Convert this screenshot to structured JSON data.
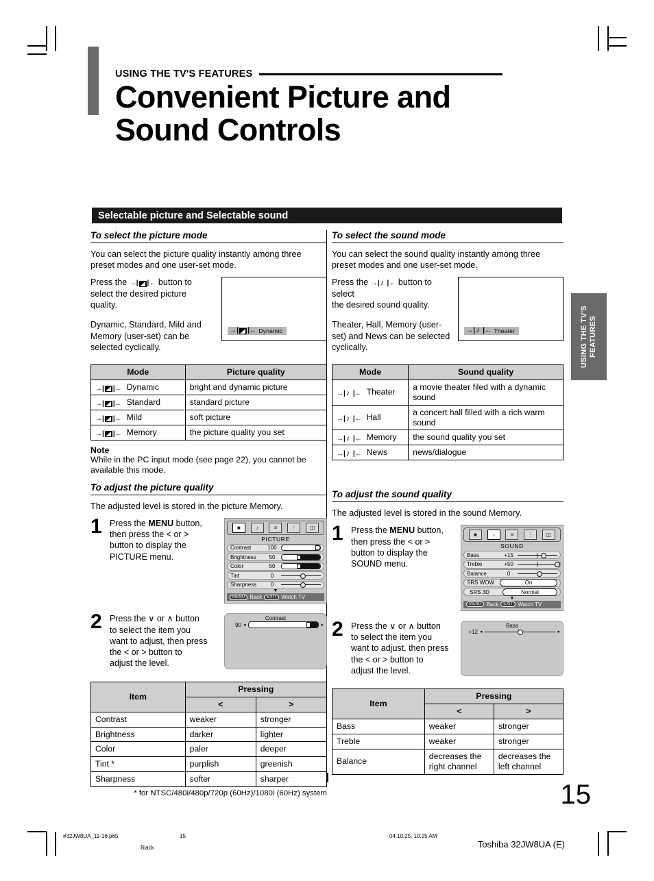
{
  "header": {
    "kicker": "USING THE TV'S FEATURES",
    "title_line1": "Convenient Picture and",
    "title_line2": "Sound Controls"
  },
  "section_bar": {
    "label": "Selectable picture and Selectable sound"
  },
  "side_tab": {
    "line1": "USING THE TV'S",
    "line2": "FEATURES"
  },
  "left": {
    "picture_mode": {
      "heading": "To select the picture mode",
      "intro": "You can select the picture quality instantly among three preset modes and one user-set mode.",
      "press": "Press the →| ◢ |← button to select the desired picture quality.",
      "press_pre": "Press the",
      "press_post": "button to",
      "press_l2": "select the desired picture",
      "press_l3": "quality.",
      "cycle_l1": "Dynamic, Standard, Mild and",
      "cycle_l2": "Memory (user-set) can be",
      "cycle_l3": "selected cyclically.",
      "osd_chip": "Dynamic"
    },
    "mode_table": {
      "headers": [
        "Mode",
        "Picture quality"
      ],
      "rows": [
        {
          "mode": "Dynamic",
          "desc": "bright and dynamic picture"
        },
        {
          "mode": "Standard",
          "desc": "standard picture"
        },
        {
          "mode": "Mild",
          "desc": "soft picture"
        },
        {
          "mode": "Memory",
          "desc": "the picture quality you set"
        }
      ]
    },
    "note": {
      "title": "Note",
      "body": "While in the PC input mode (see page 22), you cannot be available this mode."
    },
    "adjust": {
      "heading": "To adjust the picture quality",
      "intro": "The adjusted level is stored in the picture Memory.",
      "step1_num": "1",
      "step1_l1_a": "Press the",
      "step1_l1_b": "MENU",
      "step1_l1_c": "button,",
      "step1_l2": "then press the < or >",
      "step1_l3": "button to display the",
      "step1_l4": "PICTURE menu.",
      "step2_num": "2",
      "step2_l1": "Press the ∨ or ∧ button",
      "step2_l2": "to select the item you",
      "step2_l3": "want to adjust, then press",
      "step2_l4": "the < or > button to",
      "step2_l5": "adjust the level."
    },
    "osd_picture": {
      "title": "PICTURE",
      "rows": [
        {
          "label": "Contrast",
          "value": "100",
          "type": "bar",
          "fill": 0,
          "knob": 96
        },
        {
          "label": "Brightness",
          "value": "50",
          "type": "bar",
          "fill": 100,
          "knob": 48
        },
        {
          "label": "Color",
          "value": "50",
          "type": "bar",
          "fill": 100,
          "knob": 48
        },
        {
          "label": "Tint",
          "value": "0",
          "type": "line",
          "knob": 50
        },
        {
          "label": "Sharpness",
          "value": "0",
          "type": "line",
          "knob": 50
        }
      ],
      "foot_back_key": "MENU",
      "foot_back": "Back",
      "foot_exit_key": "EXIT",
      "foot_exit": "Watch TV"
    },
    "popup_bar": {
      "title": "Contrast",
      "value": "90",
      "fill": 88
    },
    "pressing_table": {
      "headers": {
        "item": "Item",
        "pressing": "Pressing",
        "left": "<",
        "right": ">"
      },
      "rows": [
        {
          "item": "Contrast",
          "left": "weaker",
          "right": "stronger"
        },
        {
          "item": "Brightness",
          "left": "darker",
          "right": "lighter"
        },
        {
          "item": "Color",
          "left": "paler",
          "right": "deeper"
        },
        {
          "item": "Tint *",
          "left": "purplish",
          "right": "greenish"
        },
        {
          "item": "Sharpness",
          "left": "softer",
          "right": "sharper"
        }
      ],
      "footnote": "* for NTSC/480i/480p/720p (60Hz)/1080i (60Hz) system"
    }
  },
  "right": {
    "sound_mode": {
      "heading": "To select the sound mode",
      "intro": "You can select the sound quality instantly among three preset modes and one user-set mode.",
      "press_pre": "Press the",
      "press_post": "button to select",
      "press_l2": "the desired sound quality.",
      "cycle_l1": "Theater, Hall, Memory (user-",
      "cycle_l2": "set) and News can be selected",
      "cycle_l3": "cyclically.",
      "osd_chip": "Theater"
    },
    "mode_table": {
      "headers": [
        "Mode",
        "Sound quality"
      ],
      "rows": [
        {
          "mode": "Theater",
          "desc": "a movie theater filed with a dynamic sound"
        },
        {
          "mode": "Hall",
          "desc": "a concert hall filled with a rich warm sound"
        },
        {
          "mode": "Memory",
          "desc": "the sound quality you set"
        },
        {
          "mode": "News",
          "desc": "news/dialogue"
        }
      ]
    },
    "adjust": {
      "heading": "To adjust the sound quality",
      "intro": "The adjusted level is stored in the sound Memory.",
      "step1_num": "1",
      "step1_l1_a": "Press the",
      "step1_l1_b": "MENU",
      "step1_l1_c": "button,",
      "step1_l2": "then press the < or >",
      "step1_l3": "button to display the",
      "step1_l4": "SOUND menu.",
      "step2_num": "2",
      "step2_l1": "Press the ∨ or ∧ button",
      "step2_l2": "to select the item you",
      "step2_l3": "want to adjust, then press",
      "step2_l4": "the < or > button to",
      "step2_l5": "adjust the level."
    },
    "osd_sound": {
      "title": "SOUND",
      "rows": [
        {
          "label": "Bass",
          "value": "+15",
          "type": "line",
          "knob": 62
        },
        {
          "label": "Treble",
          "value": "+50",
          "type": "line",
          "knob": 97
        },
        {
          "label": "Balance",
          "value": "0",
          "type": "line",
          "knob": 50
        },
        {
          "label": "SRS WOW",
          "value": "On",
          "type": "box"
        },
        {
          "label": "SRS 3D",
          "value": "Normal",
          "type": "box"
        }
      ],
      "foot_back_key": "MENU",
      "foot_back": "Back",
      "foot_exit_key": "EXIT",
      "foot_exit": "Watch TV"
    },
    "popup_bar": {
      "title": "Bass",
      "value": "+12",
      "knob": 50
    },
    "pressing_table": {
      "headers": {
        "item": "Item",
        "pressing": "Pressing",
        "left": "<",
        "right": ">"
      },
      "rows": [
        {
          "item": "Bass",
          "left": "weaker",
          "right": "stronger"
        },
        {
          "item": "Treble",
          "left": "weaker",
          "right": "stronger"
        },
        {
          "item": "Balance",
          "left": "decreases the right channel",
          "right": "decreases the left channel"
        }
      ]
    }
  },
  "page_number": "15",
  "footer": {
    "file": "#32JW8UA_11-16.p65",
    "page": "15",
    "black": "Black",
    "date": "04.10.25, 10:25 AM",
    "model": "Toshiba 32JW8UA (E)"
  }
}
